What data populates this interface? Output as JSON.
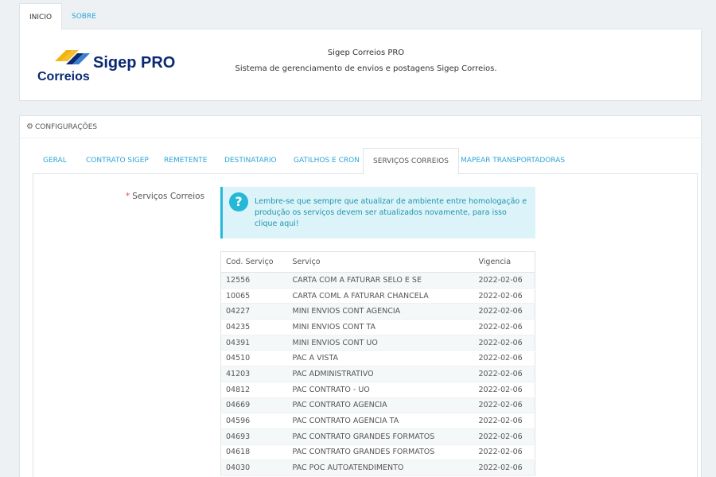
{
  "top_tabs": [
    {
      "label": "INICIO"
    },
    {
      "label": "SOBRE"
    }
  ],
  "header": {
    "logo_correios": "Correios",
    "logo_sigep": "Sigep PRO",
    "title": "Sigep Correios PRO",
    "subtitle": "Sistema de gerenciamento de envios e postagens Sigep Correios."
  },
  "config": {
    "title": "CONFIGURAÇÕES",
    "tabs": [
      {
        "label": "GERAL"
      },
      {
        "label": "CONTRATO SIGEP"
      },
      {
        "label": "REMETENTE"
      },
      {
        "label": "DESTINATARIO"
      },
      {
        "label": "GATILHOS E CRON"
      },
      {
        "label": "SERVIÇOS CORREIOS"
      },
      {
        "label": "MAPEAR TRANSPORTADORAS"
      }
    ],
    "field_label": "Serviços Correios",
    "required_mark": "*",
    "help_text": "Lembre-se que sempre que atualizar de ambiente entre homologação e produção os serviços devem ser atualizados novamente, para isso ",
    "help_link": "clique aqui!"
  },
  "table": {
    "headers": [
      "Cod. Serviço",
      "Serviço",
      "Vigencia"
    ],
    "rows": [
      [
        "12556",
        "CARTA COM A FATURAR SELO E SE",
        "2022-02-06"
      ],
      [
        "10065",
        "CARTA COML A FATURAR CHANCELA",
        "2022-02-06"
      ],
      [
        "04227",
        "MINI ENVIOS CONT AGENCIA",
        "2022-02-06"
      ],
      [
        "04235",
        "MINI ENVIOS CONT TA",
        "2022-02-06"
      ],
      [
        "04391",
        "MINI ENVIOS CONT UO",
        "2022-02-06"
      ],
      [
        "04510",
        "PAC A VISTA",
        "2022-02-06"
      ],
      [
        "41203",
        "PAC ADMINISTRATIVO",
        "2022-02-06"
      ],
      [
        "04812",
        "PAC CONTRATO - UO",
        "2022-02-06"
      ],
      [
        "04669",
        "PAC CONTRATO AGENCIA",
        "2022-02-06"
      ],
      [
        "04596",
        "PAC CONTRATO AGENCIA TA",
        "2022-02-06"
      ],
      [
        "04693",
        "PAC CONTRATO GRANDES FORMATOS",
        "2022-02-06"
      ],
      [
        "04618",
        "PAC CONTRATO GRANDES FORMATOS",
        "2022-02-06"
      ],
      [
        "04030",
        "PAC POC AUTOATENDIMENTO",
        "2022-02-06"
      ]
    ]
  },
  "colors": {
    "accent": "#25b9d7",
    "link": "#2ba5d7",
    "logo_blue": "#0b2a72",
    "logo_yellow": "#f5b40a"
  },
  "icons": {
    "config": "gears-icon",
    "help": "question-icon"
  }
}
